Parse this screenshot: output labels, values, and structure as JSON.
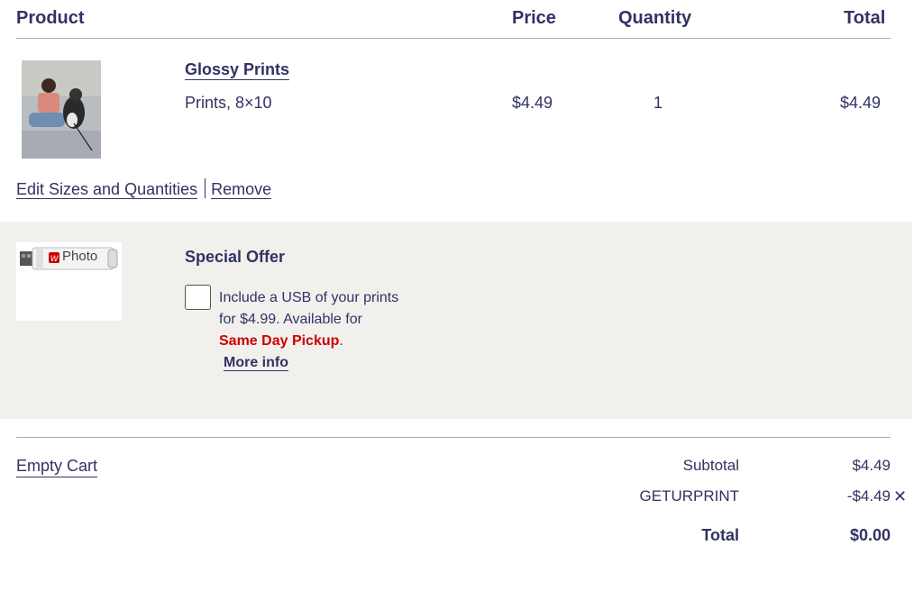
{
  "table_header": {
    "product": "Product",
    "price": "Price",
    "quantity": "Quantity",
    "total": "Total"
  },
  "item": {
    "name": "Glossy Prints",
    "description": "Prints, 8×10",
    "price": "$4.49",
    "quantity": "1",
    "total": "$4.49",
    "edit_label": "Edit Sizes and Quantities",
    "remove_label": "Remove"
  },
  "offer": {
    "usb_label": "Photo",
    "title": "Special Offer",
    "text_1": "Include a USB of your prints for $4.99. Available for",
    "pickup": "Same Day Pickup",
    "period": ".",
    "more_info": "More info"
  },
  "footer": {
    "empty_cart": "Empty Cart",
    "subtotal_label": "Subtotal",
    "subtotal_value": "$4.49",
    "promo_label": "GETURPRINT",
    "promo_value": "-$4.49",
    "remove_promo_glyph": "✕",
    "total_label": "Total",
    "total_value": "$0.00"
  },
  "colors": {
    "text": "#323264",
    "offer_bg": "#f2f0ed",
    "pickup_red": "#cc0000"
  }
}
